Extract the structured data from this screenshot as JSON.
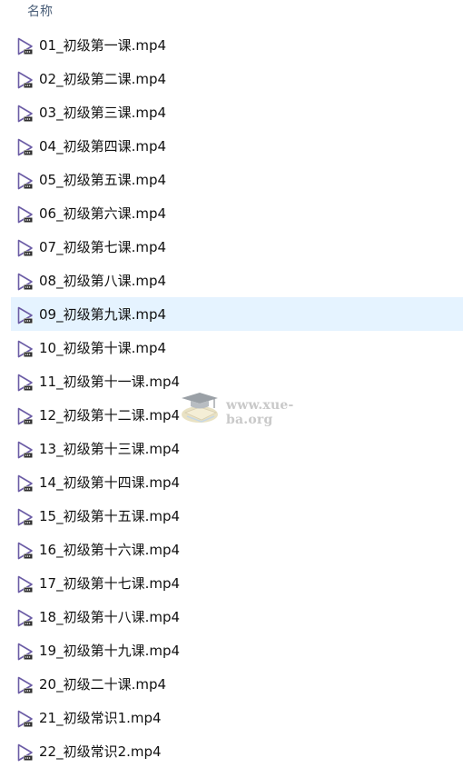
{
  "header": {
    "name_column": "名称"
  },
  "files": [
    {
      "name": "01_初级第一课.mp4",
      "icon": "video-file-icon"
    },
    {
      "name": "02_初级第二课.mp4",
      "icon": "video-file-icon"
    },
    {
      "name": "03_初级第三课.mp4",
      "icon": "video-file-icon"
    },
    {
      "name": "04_初级第四课.mp4",
      "icon": "video-file-icon"
    },
    {
      "name": "05_初级第五课.mp4",
      "icon": "video-file-icon"
    },
    {
      "name": "06_初级第六课.mp4",
      "icon": "video-file-icon"
    },
    {
      "name": "07_初级第七课.mp4",
      "icon": "video-file-icon"
    },
    {
      "name": "08_初级第八课.mp4",
      "icon": "video-file-icon"
    },
    {
      "name": "09_初级第九课.mp4",
      "icon": "video-file-icon",
      "selected": true
    },
    {
      "name": "10_初级第十课.mp4",
      "icon": "video-file-icon"
    },
    {
      "name": "11_初级第十一课.mp4",
      "icon": "video-file-icon"
    },
    {
      "name": "12_初级第十二课.mp4",
      "icon": "video-file-icon"
    },
    {
      "name": "13_初级第十三课.mp4",
      "icon": "video-file-icon"
    },
    {
      "name": "14_初级第十四课.mp4",
      "icon": "video-file-icon"
    },
    {
      "name": "15_初级第十五课.mp4",
      "icon": "video-file-icon"
    },
    {
      "name": "16_初级第十六课.mp4",
      "icon": "video-file-icon"
    },
    {
      "name": "17_初级第十七课.mp4",
      "icon": "video-file-icon"
    },
    {
      "name": "18_初级第十八课.mp4",
      "icon": "video-file-icon"
    },
    {
      "name": "19_初级第十九课.mp4",
      "icon": "video-file-icon"
    },
    {
      "name": "20_初级二十课.mp4",
      "icon": "video-file-icon"
    },
    {
      "name": "21_初级常识1.mp4",
      "icon": "video-file-icon"
    },
    {
      "name": "22_初级常识2.mp4",
      "icon": "video-file-icon"
    }
  ],
  "watermark": {
    "text": "www.xue-ba.org",
    "icon": "graduation-cap-icon"
  },
  "colors": {
    "selection": "#e5f3ff",
    "icon_stroke": "#6b5ca5",
    "header_text": "#4c607a"
  }
}
